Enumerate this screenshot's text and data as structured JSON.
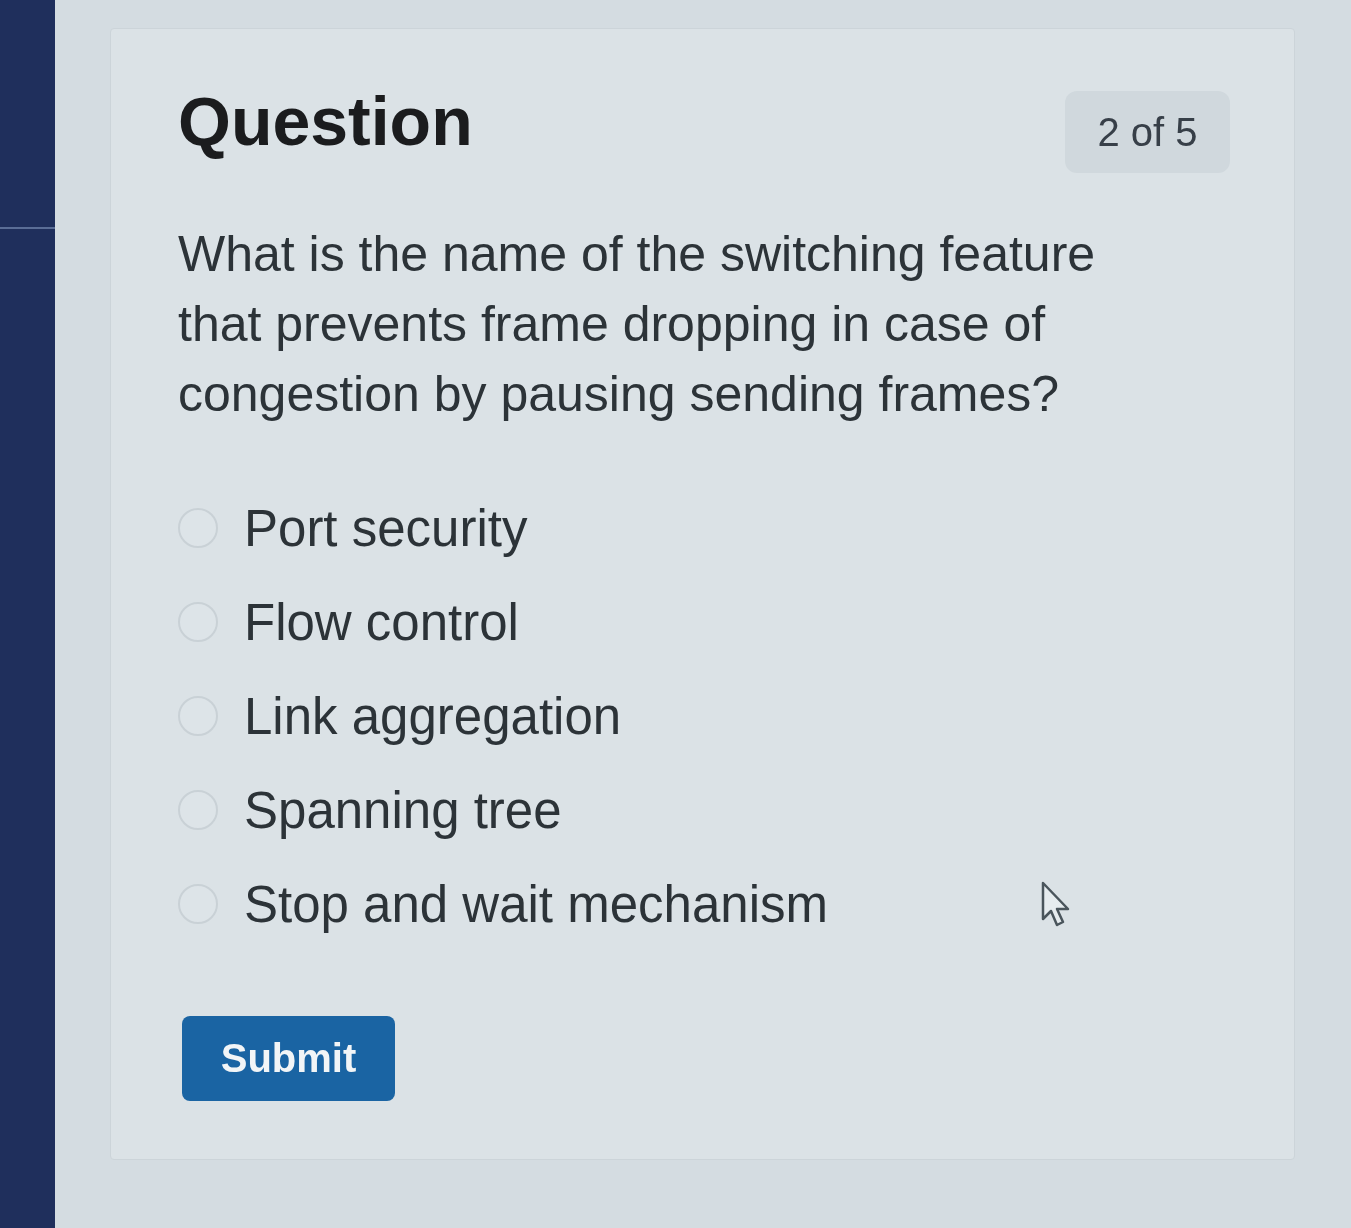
{
  "card": {
    "title": "Question",
    "progress": "2 of 5"
  },
  "question": {
    "text": "What is the name of the switching feature that prevents frame dropping in case of congestion by pausing sending frames?"
  },
  "options": [
    {
      "label": "Port security",
      "selected": false
    },
    {
      "label": "Flow control",
      "selected": false
    },
    {
      "label": "Link aggregation",
      "selected": false
    },
    {
      "label": "Spanning tree",
      "selected": false
    },
    {
      "label": "Stop and wait mechanism",
      "selected": false
    }
  ],
  "submit_button": {
    "label": "Submit"
  }
}
